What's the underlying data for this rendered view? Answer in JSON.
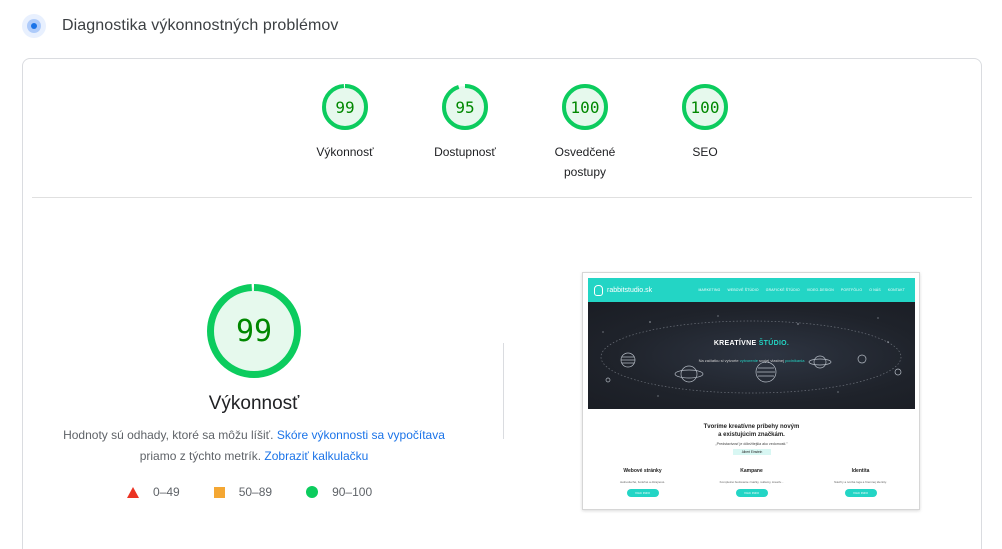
{
  "header": {
    "title": "Diagnostika výkonnostných problémov",
    "icon": "lighthouse-dot-icon"
  },
  "colors": {
    "pass": "#0ccc5e",
    "pass_text": "#008800",
    "pass_fill": "#e6f9ed",
    "average": "#f4a733",
    "fail": "#eb3323",
    "link": "#1a73e8",
    "thumb_accent": "#23d5c5"
  },
  "gauges": [
    {
      "label": "Výkonnosť",
      "score": 99
    },
    {
      "label": "Dostupnosť",
      "score": 95
    },
    {
      "label": "Osvedčené postupy",
      "score": 100
    },
    {
      "label": "SEO",
      "score": 100
    }
  ],
  "performance": {
    "score": 99,
    "title": "Výkonnosť",
    "description_prefix": "Hodnoty sú odhady, ktoré sa môžu líšiť.",
    "link_scoring": "Skóre výkonnosti sa vypočítava",
    "description_middle": "priamo z týchto metrík.",
    "link_calculator": "Zobraziť kalkulačku"
  },
  "legend": [
    {
      "range": "0–49",
      "icon": "red-triangle-icon"
    },
    {
      "range": "50–89",
      "icon": "orange-square-icon"
    },
    {
      "range": "90–100",
      "icon": "green-circle-icon"
    }
  ],
  "thumbnail": {
    "brand": "rabbitstudio.sk",
    "nav_links": [
      "MARKETING",
      "WEBOVÉ ŠTÚDIO",
      "GRAFICKÉ ŠTÚDIO",
      "VIDEO-DESIGN",
      "PORTFÓLIO",
      "O NÁS",
      "KONTAKT"
    ],
    "hero_title_a": "KREATÍVNE ",
    "hero_title_b": "ŠTÚDIO.",
    "hero_sub_a": "Na začiatku si vytvorte ",
    "hero_sub_b": "vytvorenie",
    "hero_sub_c": " svojej vlastnej ",
    "hero_sub_d": "podnikania",
    "section_title_1": "Tvoríme kreatívne príbehy novým",
    "section_title_2": "a existujúcim značkám.",
    "quote": "„Predstavivosť je dôležitejšia ako vedomosti.\"",
    "author": "Albert Einstein",
    "columns": [
      {
        "title": "Webové stránky",
        "text": "Jednoduché, funkčné a dizajnové.",
        "button": "VIAC INFO"
      },
      {
        "title": "Kampane",
        "text": "Kompletné budovanie značky, reklamy, kreatív...",
        "button": "VIAC INFO"
      },
      {
        "title": "Identita",
        "text": "Návrhy a tvorba loga a firemnej identity.",
        "button": "VIAC INFO"
      }
    ]
  }
}
